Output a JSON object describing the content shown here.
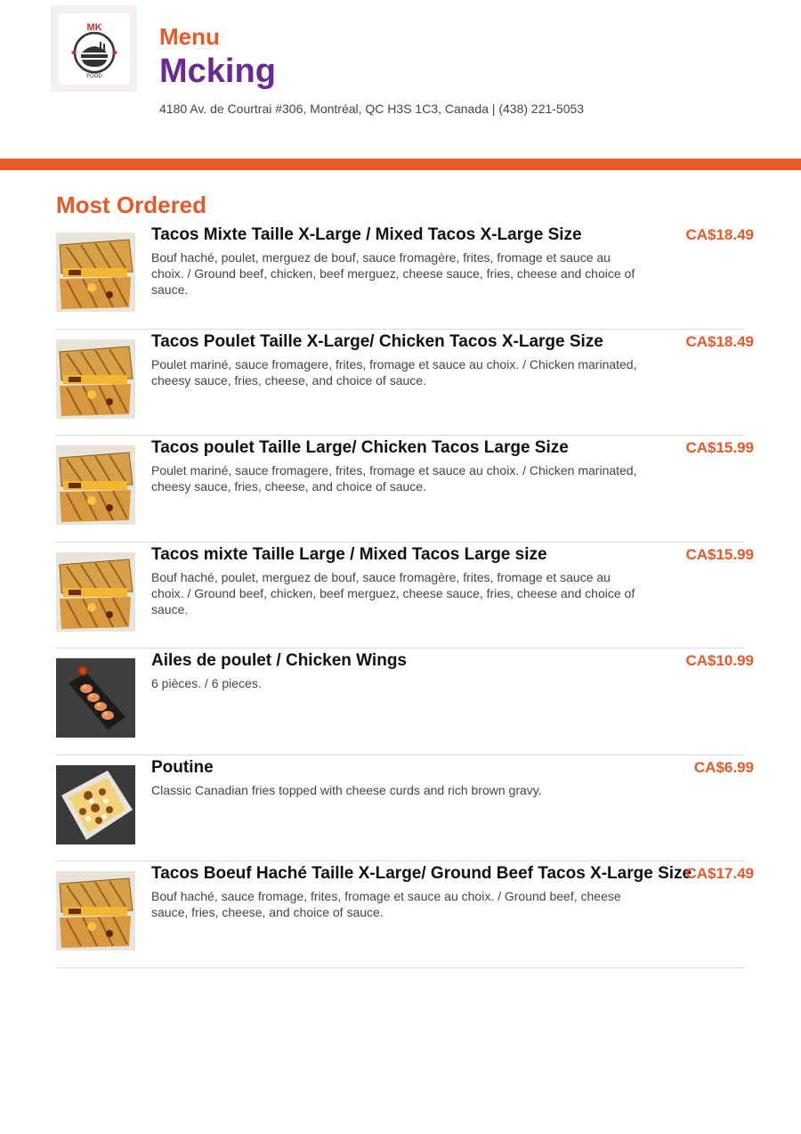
{
  "header": {
    "logo_text_top": "MK",
    "logo_text_bottom": "FOOD",
    "menu_label": "Menu",
    "restaurant_name": "Mcking",
    "address": "4180 Av. de Courtrai #306, Montréal, QC H3S 1C3, Canada | (438) 221-5053"
  },
  "colors": {
    "accent": "#e8592a",
    "brand": "#6a2a8f",
    "bar": "#ea5b2a"
  },
  "section": {
    "title": "Most Ordered",
    "items": [
      {
        "name": "Tacos Mixte Taille X-Large / Mixed Tacos X-Large Size",
        "description": "Bouf haché, poulet, merguez de bouf, sauce fromagère, frites, fromage et sauce au choix. / Ground beef, chicken, beef merguez, cheese sauce, fries, cheese and choice of sauce.",
        "price": "CA$18.49",
        "image": "tacos-photo"
      },
      {
        "name": "Tacos Poulet Taille X-Large/ Chicken Tacos X-Large Size",
        "description": "Poulet mariné, sauce fromagere, frites, fromage et sauce au choix. / Chicken marinated, cheesy sauce, fries, cheese, and choice of sauce.",
        "price": "CA$18.49",
        "image": "tacos-photo"
      },
      {
        "name": "Tacos poulet Taille Large/ Chicken Tacos Large Size",
        "description": "Poulet mariné, sauce fromagere, frites, fromage et sauce au choix. / Chicken marinated, cheesy sauce, fries, cheese, and choice of sauce.",
        "price": "CA$15.99",
        "image": "tacos-photo"
      },
      {
        "name": "Tacos mixte Taille Large / Mixed Tacos Large size",
        "description": "Bouf haché, poulet, merguez de bouf, sauce fromagère, frites, fromage et sauce au choix. / Ground beef, chicken, beef merguez, cheese sauce, fries, cheese and choice of sauce.",
        "price": "CA$15.99",
        "image": "tacos-photo"
      },
      {
        "name": "Ailes de poulet / Chicken Wings",
        "description": "6 pièces. / 6 pieces.",
        "price": "CA$10.99",
        "image": "wings-photo"
      },
      {
        "name": "Poutine",
        "description": "Classic Canadian fries topped with cheese curds and rich brown gravy.",
        "price": "CA$6.99",
        "image": "poutine-photo"
      },
      {
        "name": "Tacos Boeuf Haché Taille X-Large/  Ground Beef Tacos X-Large Size",
        "description": "Bouf haché, sauce fromage, frites, fromage et sauce au choix. / Ground beef, cheese sauce, fries, cheese, and choice of sauce.",
        "price": "CA$17.49",
        "image": "tacos-photo"
      }
    ]
  }
}
